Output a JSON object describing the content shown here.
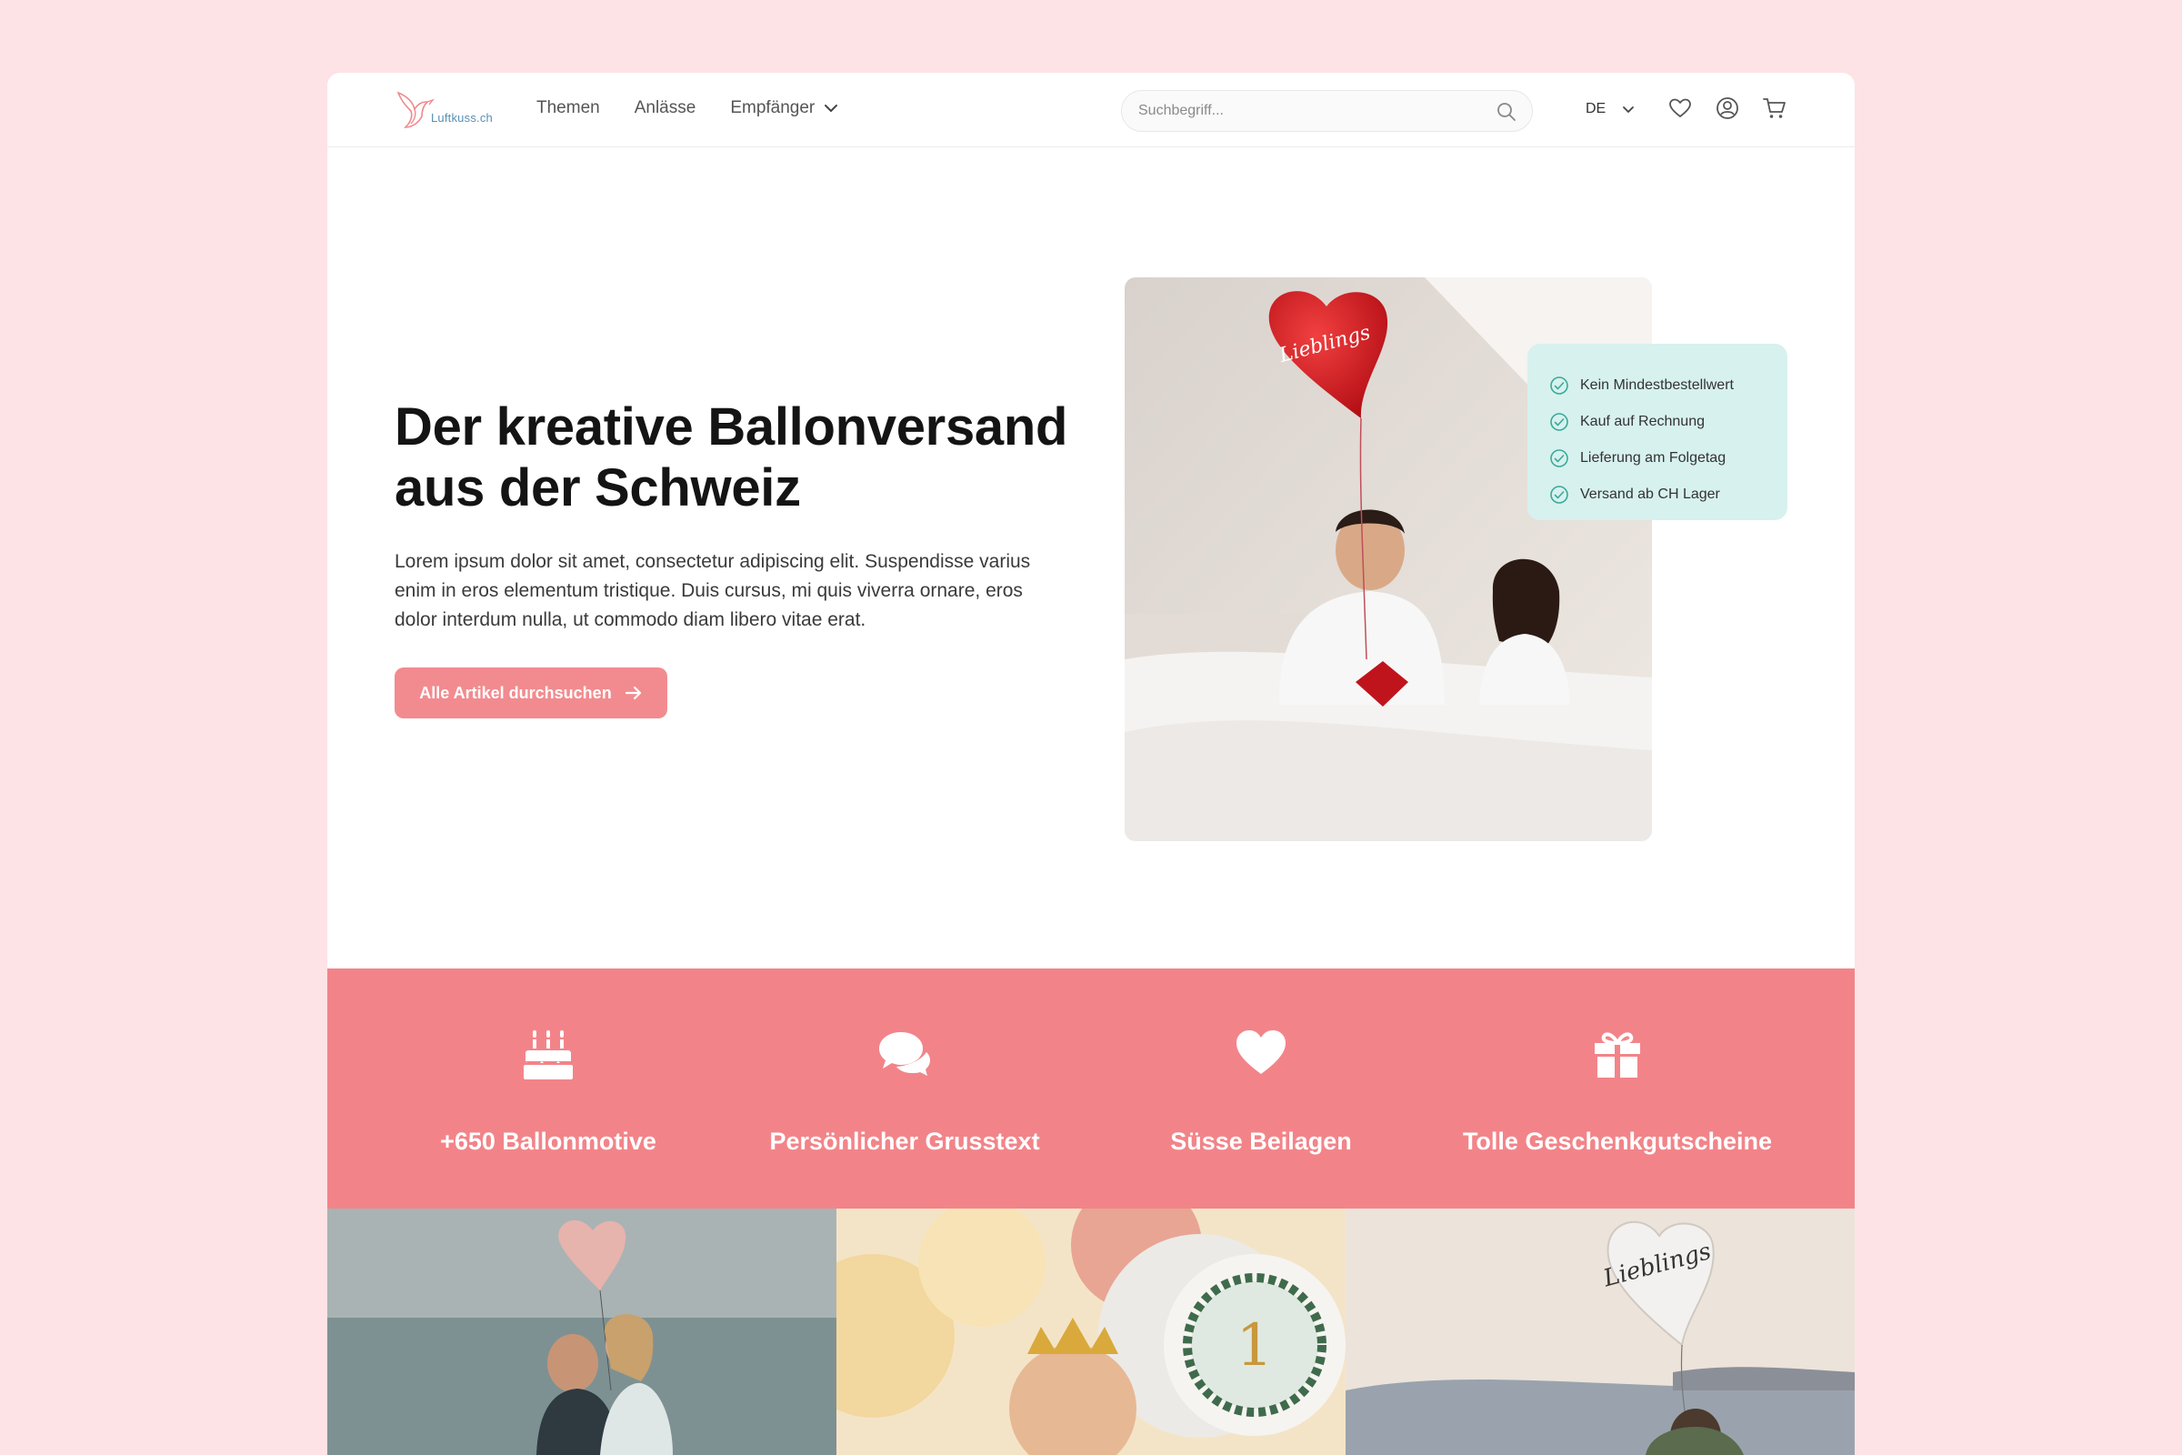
{
  "brand": {
    "name": "Luftkuss.ch"
  },
  "nav": {
    "links": [
      {
        "label": "Themen"
      },
      {
        "label": "Anlässe"
      },
      {
        "label": "Empfänger"
      }
    ],
    "search_placeholder": "Suchbegriff...",
    "language": "DE",
    "icons": [
      "heart-icon",
      "account-icon",
      "cart-icon"
    ]
  },
  "hero": {
    "title_line1": "Der kreative Ballonversand",
    "title_line2": "aus der Schweiz",
    "text": "Lorem ipsum dolor sit amet, consectetur adipiscing elit. Suspendisse varius enim in eros elementum tristique. Duis cursus, mi quis viverra ornare, eros dolor interdum nulla, ut commodo diam libero vitae erat.",
    "cta_label": "Alle Artikel durchsuchen",
    "usps": [
      {
        "label": "Kein Mindestbestellwert"
      },
      {
        "label": "Kauf auf Rechnung"
      },
      {
        "label": "Lieferung am Folgetag"
      },
      {
        "label": "Versand ab CH Lager"
      }
    ]
  },
  "features": [
    {
      "icon": "cake-icon",
      "label": "+650 Ballonmotive"
    },
    {
      "icon": "speech-bubbles-icon",
      "label": "Persönlicher Grusstext"
    },
    {
      "icon": "heart-icon",
      "label": "Süsse Beilagen"
    },
    {
      "icon": "gift-icon",
      "label": "Tolle Geschenkgutscheine"
    }
  ],
  "colors": {
    "background": "#fde3e6",
    "accent": "#f28489",
    "cta": "#f28b8f",
    "usp_card": "#d7f1ee",
    "check": "#3aa999"
  }
}
